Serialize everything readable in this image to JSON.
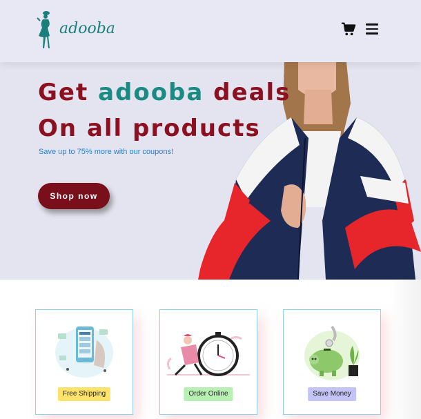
{
  "header": {
    "logo_text": "adooba",
    "cart_icon": "shopping-cart-icon",
    "menu_icon": "hamburger-menu-icon"
  },
  "hero": {
    "title_prefix": "Get ",
    "title_brand": "adooba",
    "title_suffix": " deals",
    "title_line2": "On all products",
    "subtitle": "Save up to 75% more with our coupons!",
    "cta_label": "Shop now"
  },
  "features": [
    {
      "label": "Free Shipping",
      "badge_color": "#fde36b",
      "icon": "phone-shipping-illustration"
    },
    {
      "label": "Order Online",
      "badge_color": "#b7f0b2",
      "icon": "delivery-clock-illustration"
    },
    {
      "label": "Save Money",
      "badge_color": "#c3c4f5",
      "icon": "piggy-bank-illustration"
    }
  ],
  "colors": {
    "brand_teal": "#1a8a83",
    "brand_red": "#8b1020",
    "header_bg": "#e7e8f4",
    "hero_bg": "#e4e4f0",
    "subtitle_blue": "#1f7fd6",
    "card_border": "#8fd3ea"
  }
}
